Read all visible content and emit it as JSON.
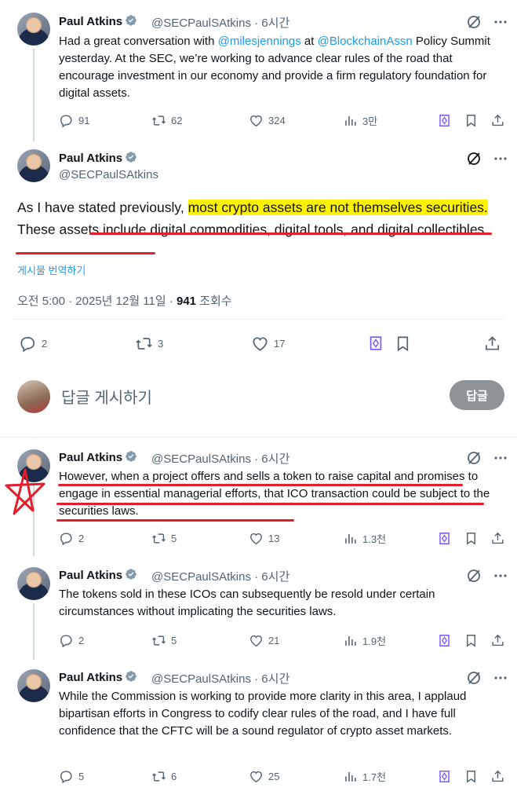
{
  "tweets": [
    {
      "name": "Paul Atkins",
      "handle": "@SECPaulSAtkins",
      "time": "6시간",
      "text_pre": "Had a great conversation with ",
      "mention1": "@milesjennings",
      "text_mid": " at ",
      "mention2": "@BlockchainAssn",
      "text_post": " Policy Summit yesterday. At the SEC, we’re working to advance clear rules of the road that encourage investment in our economy and provide a firm regulatory foundation for digital assets.",
      "replies": "91",
      "reposts": "62",
      "likes": "324",
      "views": "3만"
    },
    {
      "name": "Paul Atkins",
      "handle": "@SECPaulSAtkins",
      "text_intro": "As I have stated previously, ",
      "text_highlight": "most crypto assets are not themselves securities.",
      "text_rest": " These assets include digital commodities, digital tools, and digital collectibles.",
      "translate": "게시물 번역하기",
      "timestamp": "오전 5:00 · 2025년 12월 11일 · ",
      "views_count": "941",
      "views_label": " 조회수",
      "replies": "2",
      "reposts": "3",
      "likes": "17"
    },
    {
      "name": "Paul Atkins",
      "handle": "@SECPaulSAtkins",
      "time": "6시간",
      "text": "However, when a project offers and sells a token to raise capital and promises to engage in essential managerial efforts, that ICO transaction could be subject to the securities laws.",
      "replies": "2",
      "reposts": "5",
      "likes": "13",
      "views": "1.3천"
    },
    {
      "name": "Paul Atkins",
      "handle": "@SECPaulSAtkins",
      "time": "6시간",
      "text": "The tokens sold in these ICOs can subsequently be resold under certain circumstances without implicating the securities laws.",
      "replies": "2",
      "reposts": "5",
      "likes": "21",
      "views": "1.9천"
    },
    {
      "name": "Paul Atkins",
      "handle": "@SECPaulSAtkins",
      "time": "6시간",
      "text": "While the Commission is working to provide more clarity in this area, I applaud bipartisan efforts in Congress to codify clear rules of the road, and I have full confidence that the CFTC will be a sound regulator of crypto asset markets.",
      "replies": "5",
      "reposts": "6",
      "likes": "25",
      "views": "1.7천"
    }
  ],
  "reply_composer": {
    "placeholder": "답글 게시하기",
    "button": "답글"
  },
  "colors": {
    "accent": "#1d9bf0",
    "highlight": "#fff200",
    "annotation_red": "#e41f2b",
    "grok_purple": "#7856ff"
  },
  "icons": [
    "verified-badge-icon",
    "grok-icon",
    "more-icon",
    "reply-icon",
    "repost-icon",
    "like-icon",
    "views-icon",
    "grok-analyze-icon",
    "bookmark-icon",
    "share-icon",
    "star-annotation"
  ]
}
